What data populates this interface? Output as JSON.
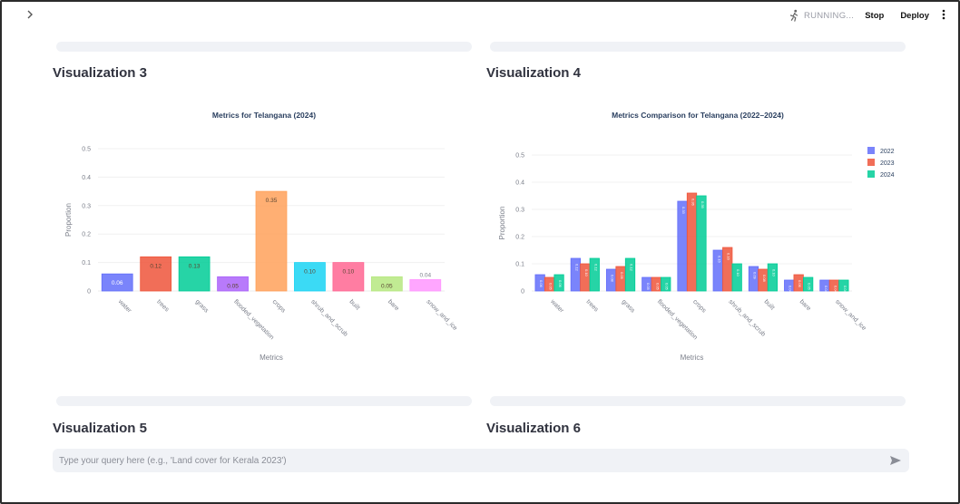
{
  "topbar": {
    "status": "RUNNING...",
    "stop_label": "Stop",
    "deploy_label": "Deploy"
  },
  "sections": {
    "viz3_title": "Visualization 3",
    "viz4_title": "Visualization 4",
    "viz5_title": "Visualization 5",
    "viz6_title": "Visualization 6"
  },
  "query": {
    "placeholder": "Type your query here (e.g., 'Land cover for Kerala 2023')"
  },
  "colors": {
    "accent": "#ff4b4b",
    "panel": "#f0f2f6"
  },
  "chart_data": [
    {
      "type": "bar",
      "title": "Metrics for Telangana (2024)",
      "xlabel": "Metrics",
      "ylabel": "Proportion",
      "ylim": [
        0,
        0.5
      ],
      "yticks": [
        "0",
        "0.1",
        "0.2",
        "0.3",
        "0.4",
        "0.5"
      ],
      "categories": [
        "water",
        "trees",
        "grass",
        "flooded_vegetation",
        "crops",
        "shrub_and_scrub",
        "built",
        "bare",
        "snow_and_ice"
      ],
      "values": [
        0.06,
        0.12,
        0.12,
        0.05,
        0.35,
        0.1,
        0.1,
        0.05,
        0.04
      ],
      "data_labels": [
        "0.06",
        "0.12",
        "0.13",
        "0.05",
        "0.35",
        "0.10",
        "0.10",
        "0.05",
        "0.04"
      ],
      "colors": [
        "#636efa",
        "#ef553b",
        "#00cc96",
        "#ab63fa",
        "#ffa15a",
        "#19d3f3",
        "#ff6692",
        "#b6e880",
        "#ff97ff"
      ],
      "grid": true,
      "legend": false
    },
    {
      "type": "bar",
      "title": "Metrics Comparison for Telangana (2022–2024)",
      "xlabel": "Metrics",
      "ylabel": "Proportion",
      "ylim": [
        0,
        0.5
      ],
      "yticks": [
        "0",
        "0.1",
        "0.2",
        "0.3",
        "0.4",
        "0.5"
      ],
      "categories": [
        "water",
        "trees",
        "grass",
        "flooded_vegetation",
        "crops",
        "shrub_and_scrub",
        "built",
        "bare",
        "snow_and_ice"
      ],
      "series": [
        {
          "name": "2022",
          "color": "#636efa",
          "values": [
            0.06,
            0.12,
            0.08,
            0.05,
            0.33,
            0.15,
            0.09,
            0.04,
            0.04
          ]
        },
        {
          "name": "2023",
          "color": "#ef553b",
          "values": [
            0.05,
            0.1,
            0.09,
            0.05,
            0.36,
            0.16,
            0.08,
            0.06,
            0.04
          ]
        },
        {
          "name": "2024",
          "color": "#00cc96",
          "values": [
            0.06,
            0.12,
            0.12,
            0.05,
            0.35,
            0.1,
            0.1,
            0.05,
            0.04
          ]
        }
      ],
      "grid": true,
      "legend": "top-right"
    }
  ]
}
